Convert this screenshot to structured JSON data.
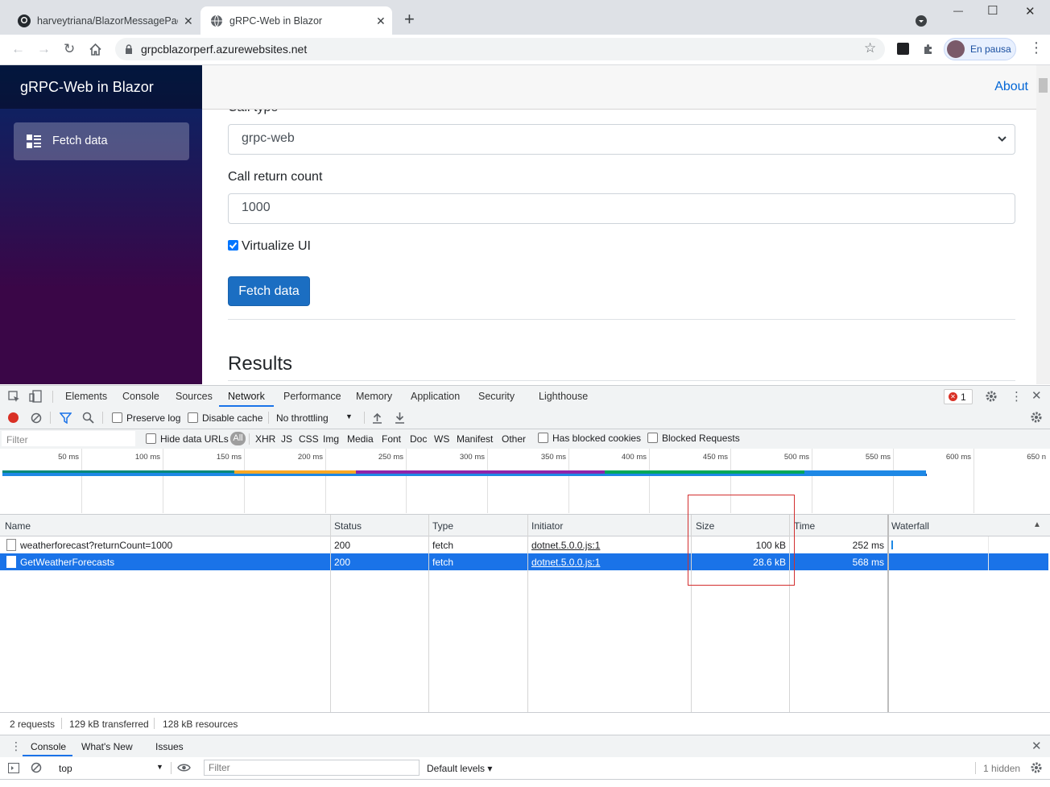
{
  "browser": {
    "tabs": [
      {
        "title": "harveytriana/BlazorMessagePack",
        "close": "✕"
      },
      {
        "title": "gRPC-Web in Blazor",
        "close": "✕"
      }
    ],
    "new_tab": "+",
    "window_controls": {
      "minimize": "—",
      "maximize": "☐",
      "close": "✕"
    },
    "url": "grpcblazorperf.azurewebsites.net",
    "profile_label": "En pausa"
  },
  "page": {
    "brand": "gRPC-Web in Blazor",
    "nav_item": "Fetch data",
    "about_link": "About",
    "call_type_label": "Call type",
    "call_type_value": "grpc-web",
    "return_count_label": "Call return count",
    "return_count_value": "1000",
    "virtualize_label": "Virtualize UI",
    "fetch_button": "Fetch data",
    "results_heading": "Results"
  },
  "devtools": {
    "tabs": [
      "Elements",
      "Console",
      "Sources",
      "Network",
      "Performance",
      "Memory",
      "Application",
      "Security",
      "Lighthouse"
    ],
    "active_tab": "Network",
    "error_count": "1",
    "toolbar": {
      "preserve_log": "Preserve log",
      "disable_cache": "Disable cache",
      "throttling": "No throttling"
    },
    "filter_placeholder": "Filter",
    "hide_data_urls": "Hide data URLs",
    "filter_types": [
      "All",
      "XHR",
      "JS",
      "CSS",
      "Img",
      "Media",
      "Font",
      "Doc",
      "WS",
      "Manifest",
      "Other"
    ],
    "has_blocked_cookies": "Has blocked cookies",
    "blocked_requests": "Blocked Requests",
    "timeline_ticks": [
      "50 ms",
      "100 ms",
      "150 ms",
      "200 ms",
      "250 ms",
      "300 ms",
      "350 ms",
      "400 ms",
      "450 ms",
      "500 ms",
      "550 ms",
      "600 ms",
      "650 n"
    ],
    "columns": [
      "Name",
      "Status",
      "Type",
      "Initiator",
      "Size",
      "Time",
      "Waterfall"
    ],
    "requests": [
      {
        "name": "weatherforecast?returnCount=1000",
        "status": "200",
        "type": "fetch",
        "initiator": "dotnet.5.0.0.js:1",
        "size": "100 kB",
        "time": "252 ms"
      },
      {
        "name": "GetWeatherForecasts",
        "status": "200",
        "type": "fetch",
        "initiator": "dotnet.5.0.0.js:1",
        "size": "28.6 kB",
        "time": "568 ms"
      }
    ],
    "summary": {
      "requests": "2 requests",
      "transferred": "129 kB transferred",
      "resources": "128 kB resources"
    },
    "drawer_tabs": [
      "Console",
      "What's New",
      "Issues"
    ],
    "console": {
      "context": "top",
      "filter_placeholder": "Filter",
      "levels": "Default levels ▾",
      "hidden": "1 hidden"
    }
  },
  "colors": {
    "accent": "#1a73e8",
    "selected_row": "#1a73e8",
    "button": "#1b6ec2",
    "sidebar_top": "#052767",
    "sidebar_bottom": "#3a0647",
    "highlight_box": "#d32f2f"
  }
}
